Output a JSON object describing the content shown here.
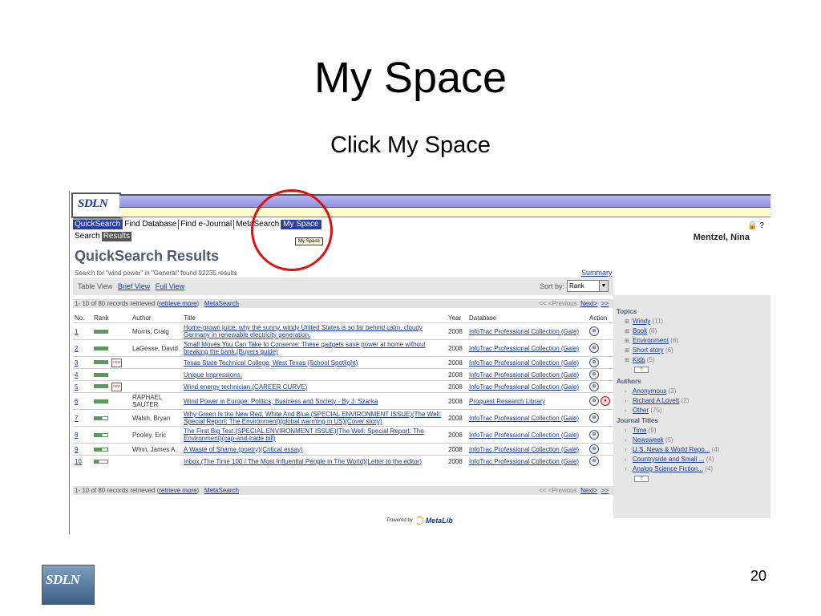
{
  "slide": {
    "title": "My Space",
    "subtitle": "Click My Space",
    "page_number": "20",
    "footer_logo_text": "SDLN"
  },
  "app": {
    "logo_text": "SDLN",
    "nav_tabs": [
      {
        "label": "QuickSearch",
        "active": true
      },
      {
        "label": "Find Database",
        "active": false
      },
      {
        "label": "Find e-Journal",
        "active": false
      },
      {
        "label": "MetaSearch",
        "active": false
      },
      {
        "label": "My Space",
        "active": true
      }
    ],
    "sub_tabs": [
      {
        "label": "Search",
        "active": false
      },
      {
        "label": "Results",
        "active": true
      }
    ],
    "tooltip": "My Space",
    "top_icons": "🔒 ?",
    "user_name": "Mentzel, Nina",
    "results_title": "QuickSearch Results",
    "search_info": "Search for \"wind power\" in \"General\" found 92235 results",
    "summary_link": "Summary",
    "views": {
      "table": "Table View",
      "brief": "Brief View",
      "full": "Full View"
    },
    "sort_by_label": "Sort by:",
    "sort_value": "Rank",
    "records_bar": {
      "range": "1- 10 of 80 records retrieved (",
      "retrieve_more": "retrieve more",
      "close": ")",
      "metasearch": "MetaSearch",
      "prev": "<< <Previous",
      "next": "Next>",
      "last": ">>"
    },
    "columns": {
      "no": "No.",
      "rank": "Rank",
      "author": "Author",
      "title": "Title",
      "year": "Year",
      "database": "Database",
      "action": "Action"
    },
    "rows": [
      {
        "no": "1",
        "author": "Morris, Craig",
        "title": "Home-grown juice: why the sunny, windy United States is so far behind calm, cloudy Germany in renewable electricity generation.",
        "year": "2008",
        "database": "InfoTrac Professional Collection (Gale)",
        "rank": 1.0,
        "new": false,
        "extra_icon": false
      },
      {
        "no": "2",
        "author": "LaGesse, David",
        "title": "Small Moves You Can Take to Conserve: These gadgets save power at home without breaking the bank.(Buyers guide)",
        "year": "2008",
        "database": "InfoTrac Professional Collection (Gale)",
        "rank": 1.0,
        "new": false,
        "extra_icon": false
      },
      {
        "no": "3",
        "author": "",
        "title": "Texas State Technical College, West Texas (School Spotlight)",
        "year": "2008",
        "database": "InfoTrac Professional Collection (Gale)",
        "rank": 1.0,
        "new": true,
        "extra_icon": false
      },
      {
        "no": "4",
        "author": "",
        "title": "Unique Impressions.",
        "year": "2008",
        "database": "InfoTrac Professional Collection (Gale)",
        "rank": 1.0,
        "new": false,
        "extra_icon": false
      },
      {
        "no": "5",
        "author": "",
        "title": "Wind energy technician.(CAREER CURVE)",
        "year": "2008",
        "database": "InfoTrac Professional Collection (Gale)",
        "rank": 1.0,
        "new": true,
        "extra_icon": false
      },
      {
        "no": "6",
        "author": "RAPHAEL SAUTER",
        "title": "Wind Power in Europe: Politics, Business and Society - By J. Szarka",
        "year": "2008",
        "database": "Proquest Research Library",
        "rank": 1.0,
        "new": false,
        "extra_icon": true
      },
      {
        "no": "7",
        "author": "Walsh, Bryan",
        "title": "Why Green Is the New Red, White And Blue.(SPECIAL ENVIRONMENT ISSUE)(The Well: Special Report: The Environment)(global warming in US)(Cover story)",
        "year": "2008",
        "database": "InfoTrac Professional Collection (Gale)",
        "rank": 0.75,
        "new": false,
        "extra_icon": false
      },
      {
        "no": "8",
        "author": "Pooley, Eric",
        "title": "The First Big Test.(SPECIAL ENVIRONMENT ISSUE)(The Well: Special Report: The Environment)(cap-and-trade bill)",
        "year": "2008",
        "database": "InfoTrac Professional Collection (Gale)",
        "rank": 0.6,
        "new": false,
        "extra_icon": false
      },
      {
        "no": "9",
        "author": "Winn, James A.",
        "title": "A Waste of Shame.(poetry)(Critical essay)",
        "year": "2008",
        "database": "InfoTrac Professional Collection (Gale)",
        "rank": 0.6,
        "new": false,
        "extra_icon": false
      },
      {
        "no": "10",
        "author": "",
        "title": "Inbox.(The Time 100 / The Most Influential People in The World)(Letter to the editor)",
        "year": "2008",
        "database": "InfoTrac Professional Collection (Gale)",
        "rank": 0.35,
        "new": false,
        "extra_icon": false
      }
    ],
    "sidebar": {
      "topics_heading": "Topics",
      "topics": [
        {
          "label": "Windy",
          "count": "(11)"
        },
        {
          "label": "Book",
          "count": "(6)"
        },
        {
          "label": "Environment",
          "count": "(6)"
        },
        {
          "label": "Short story",
          "count": "(6)"
        },
        {
          "label": "Kids",
          "count": "(5)"
        }
      ],
      "authors_heading": "Authors",
      "authors": [
        {
          "label": "Anonymous",
          "count": "(3)"
        },
        {
          "label": "Richard A Lovett",
          "count": "(2)"
        },
        {
          "label": "Other",
          "count": "(75)"
        }
      ],
      "journals_heading": "Journal Titles",
      "journals": [
        {
          "label": "Time",
          "count": "(9)"
        },
        {
          "label": "Newsweek",
          "count": "(5)"
        },
        {
          "label": "U.S. News & World Repo...",
          "count": "(4)"
        },
        {
          "label": "Countryside and Small ...",
          "count": "(4)"
        },
        {
          "label": "Analog Science Fiction...",
          "count": "(4)"
        }
      ]
    },
    "powered_by": "Powered by",
    "metalib": "MetaLib",
    "new_badge": "new"
  }
}
